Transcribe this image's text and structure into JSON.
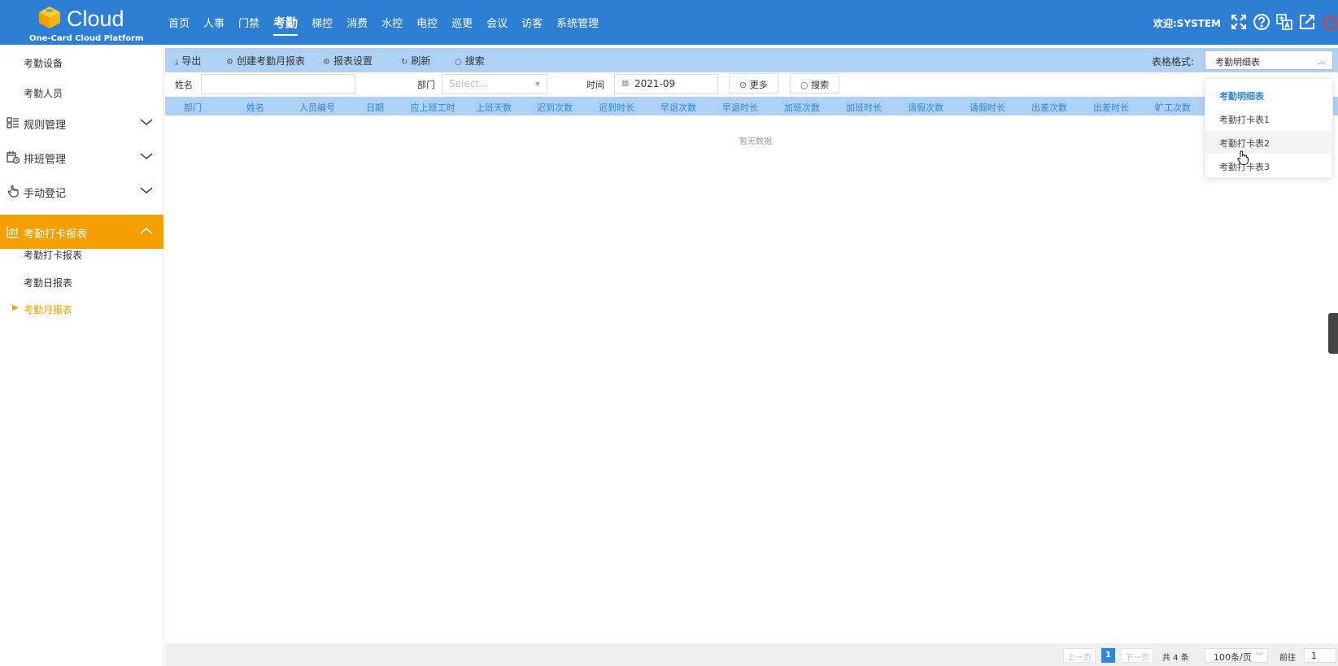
{
  "brand": {
    "name": "Cloud",
    "tagline": "One-Card Cloud Platform"
  },
  "topnav": [
    {
      "label": "首页"
    },
    {
      "label": "人事"
    },
    {
      "label": "门禁"
    },
    {
      "label": "考勤",
      "active": true
    },
    {
      "label": "梯控"
    },
    {
      "label": "消费"
    },
    {
      "label": "水控"
    },
    {
      "label": "电控"
    },
    {
      "label": "巡更"
    },
    {
      "label": "会议"
    },
    {
      "label": "访客"
    },
    {
      "label": "系统管理"
    }
  ],
  "welcome": "欢迎:SYSTEM",
  "header_icons": [
    "fullscreen-icon",
    "help-icon",
    "language-icon",
    "external-link-icon",
    "power-icon"
  ],
  "sidebar": {
    "top_items": [
      "考勤设备",
      "考勤人员"
    ],
    "groups": [
      {
        "label": "规则管理",
        "icon": "rules-list-icon"
      },
      {
        "label": "排班管理",
        "icon": "schedule-calendar-icon"
      },
      {
        "label": "手动登记",
        "icon": "hand-pointer-icon"
      },
      {
        "label": "考勤打卡报表",
        "icon": "chart-icon",
        "active": true
      }
    ],
    "sub_items": [
      "考勤打卡报表",
      "考勤日报表",
      "考勤月报表"
    ],
    "current": "考勤月报表"
  },
  "toolbar": {
    "export": "导出",
    "create_monthly": "创建考勤月报表",
    "report_settings": "报表设置",
    "refresh": "刷新",
    "search": "搜索",
    "format_label": "表格格式:",
    "format_value": "考勤明细表"
  },
  "filters": {
    "name_label": "姓名",
    "name_value": "",
    "dept_label": "部门",
    "dept_placeholder": "Select...",
    "time_label": "时间",
    "time_value": "2021-09",
    "more": "更多",
    "search": "搜索"
  },
  "table": {
    "columns": [
      "部门",
      "姓名",
      "人员编号",
      "日期",
      "应上班工时",
      "上班天数",
      "迟到次数",
      "迟到时长",
      "早退次数",
      "早退时长",
      "加班次数",
      "加班时长",
      "请假次数",
      "请假时长",
      "出差次数",
      "出差时长",
      "旷工次数"
    ],
    "empty_text": "暂无数据"
  },
  "dropdown": {
    "options": [
      "考勤明细表",
      "考勤打卡表1",
      "考勤打卡表2",
      "考勤打卡表3"
    ],
    "selected": "考勤明细表",
    "hovered": "考勤打卡表2"
  },
  "pagination": {
    "prev": "上一页",
    "current_page": "1",
    "next": "下一页",
    "total": "共 4 条",
    "page_size": "100条/页",
    "goto_label": "前往",
    "goto_value": "1"
  },
  "colors": {
    "header": "#2d7fd6",
    "accent": "#f5a000",
    "table_header": "#aed1f5",
    "link": "#2e86de"
  }
}
